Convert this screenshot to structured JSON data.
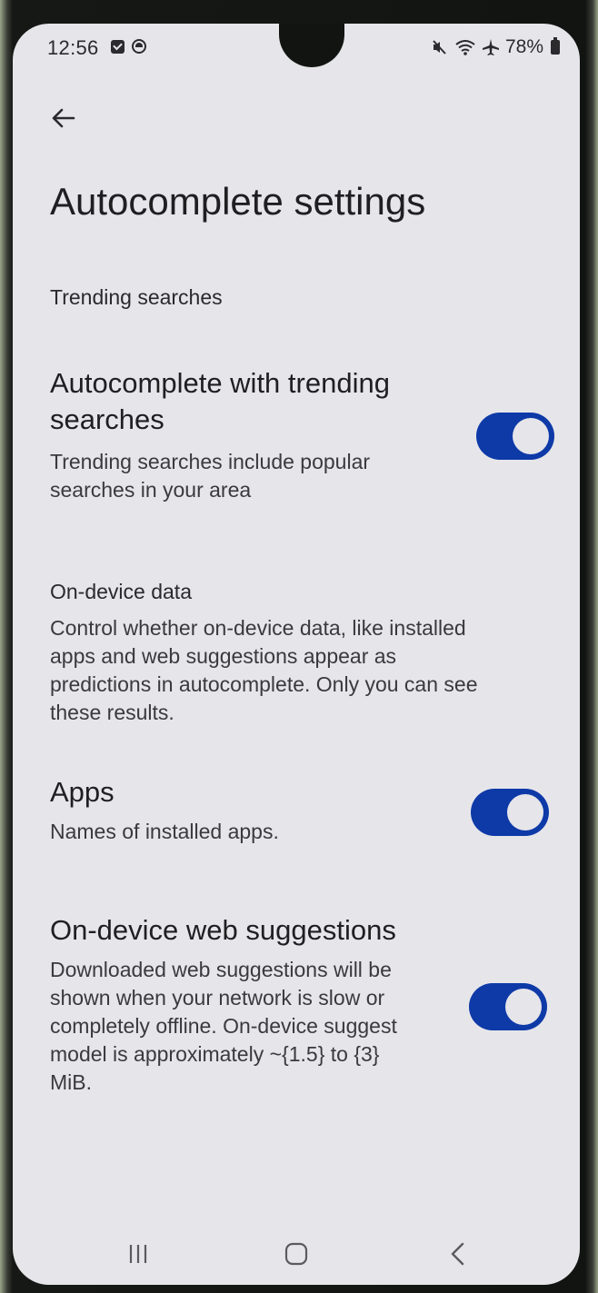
{
  "status_bar": {
    "time": "12:56",
    "battery": "78%",
    "icons_left": [
      "check-square-icon",
      "clock-circle-icon"
    ],
    "icons_right": [
      "mute-icon",
      "wifi-icon",
      "airplane-icon",
      "battery-icon"
    ]
  },
  "header": {
    "back_icon": "arrow-left-icon",
    "title": "Autocomplete settings"
  },
  "sections": {
    "trending": {
      "header": "Trending searches",
      "item_title_line1": "Autocomplete with trending",
      "item_title_line2": "searches",
      "item_sub_line1": "Trending searches include popular",
      "item_sub_line2": "searches in your area",
      "toggle_on": true
    },
    "on_device": {
      "header": "On-device data",
      "desc_line1": "Control whether on-device data, like installed",
      "desc_line2": "apps and web suggestions appear as",
      "desc_line3": "predictions in autocomplete. Only you can see",
      "desc_line4": "these results."
    },
    "apps": {
      "title": "Apps",
      "sub": "Names of installed apps.",
      "toggle_on": true
    },
    "web_suggestions": {
      "title": "On-device web suggestions",
      "desc_line1": "Downloaded web suggestions will be",
      "desc_line2": "shown when your network is slow or",
      "desc_line3": "completely offline. On-device suggest",
      "desc_line4": "model is approximately ~{1.5} to {3}",
      "desc_line5": "MiB.",
      "toggle_on": true
    }
  },
  "nav_bar": {
    "buttons": [
      "recents-icon",
      "home-icon",
      "back-chevron-icon"
    ]
  },
  "colors": {
    "toggle_on": "#0e3aa8",
    "screen_bg": "#e6e6ea",
    "text_primary": "#1f1f22"
  }
}
